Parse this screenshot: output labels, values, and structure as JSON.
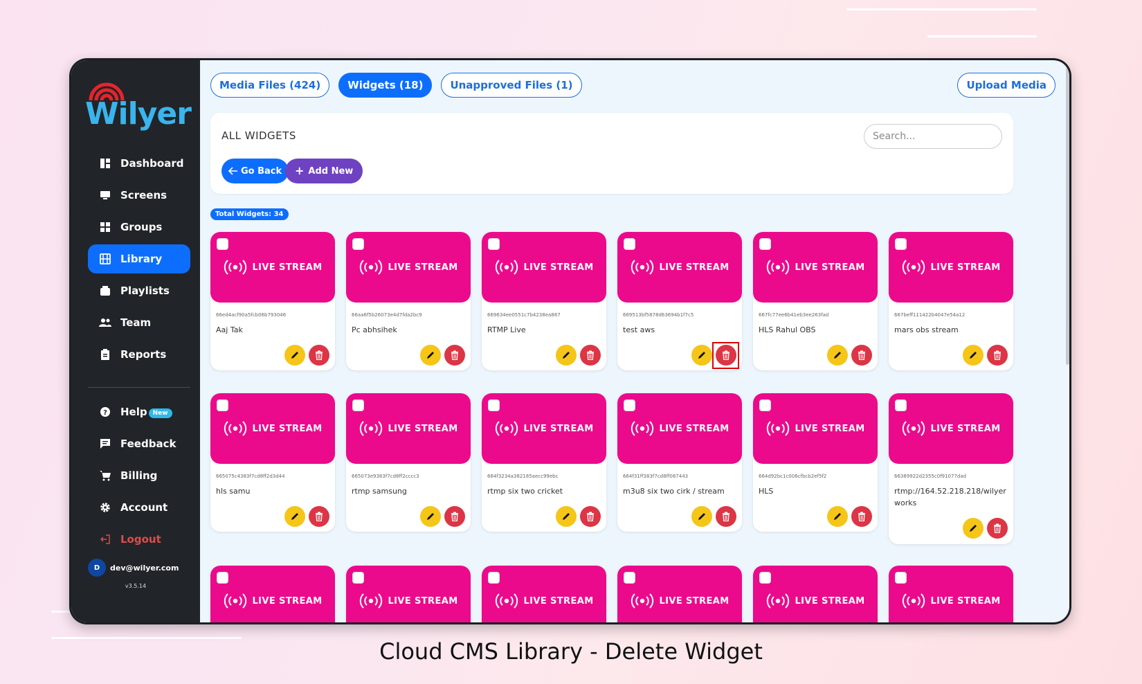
{
  "caption": "Cloud CMS Library - Delete Widget",
  "colors": {
    "primary": "#0d6efd",
    "widget_pink": "#ec0a8c",
    "edit": "#f5c518",
    "delete": "#dc3545",
    "add_new": "#6f42c1"
  },
  "brand": {
    "name": "Wilyer"
  },
  "sidebar": {
    "items": [
      {
        "label": "Dashboard",
        "icon": "dashboard-icon"
      },
      {
        "label": "Screens",
        "icon": "monitor-icon"
      },
      {
        "label": "Groups",
        "icon": "grid-icon"
      },
      {
        "label": "Library",
        "icon": "film-icon",
        "active": true
      },
      {
        "label": "Playlists",
        "icon": "playlist-icon"
      },
      {
        "label": "Team",
        "icon": "team-icon"
      },
      {
        "label": "Reports",
        "icon": "clipboard-icon"
      }
    ],
    "items2": [
      {
        "label": "Help",
        "icon": "help-icon",
        "badge": "New"
      },
      {
        "label": "Feedback",
        "icon": "feedback-icon"
      },
      {
        "label": "Billing",
        "icon": "cart-icon"
      },
      {
        "label": "Account",
        "icon": "gear-icon"
      },
      {
        "label": "Logout",
        "icon": "logout-icon"
      }
    ],
    "user": {
      "initial": "D",
      "email": "dev@wilyer.com"
    },
    "version": "v3.5.14"
  },
  "tabs": [
    {
      "label": "Media Files (424)"
    },
    {
      "label": "Widgets (18)",
      "active": true
    },
    {
      "label": "Unapproved Files (1)"
    }
  ],
  "upload_label": "Upload Media",
  "panel": {
    "title": "ALL WIDGETS",
    "search_placeholder": "Search...",
    "go_back": "Go Back",
    "add_new": "Add New"
  },
  "total_label": "Total Widgets: 34",
  "widget_label": "LIVE STREAM",
  "widgets": [
    {
      "id": "66ed4acf90a5fcb06b793046",
      "name": "Aaj Tak"
    },
    {
      "id": "66aa6f5b26073e4d7fda2bc9",
      "name": "Pc abhsihek"
    },
    {
      "id": "669634ee0551c7b4238ea887",
      "name": "RTMP Live"
    },
    {
      "id": "669513bf5878d63694b1f7c5",
      "name": "test aws",
      "highlight_delete": true
    },
    {
      "id": "667fc77ee6b41eb3ee263fad",
      "name": "HLS Rahul OBS"
    },
    {
      "id": "667beff111422b4047e54a12",
      "name": "mars obs stream"
    },
    {
      "id": "665075c4383f7cd8ff2d3d44",
      "name": "hls samu"
    },
    {
      "id": "665073e9383f7cd8ff2cccc3",
      "name": "rtmp samsung"
    },
    {
      "id": "664f3234a382185aecc99ebc",
      "name": "rtmp six two cricket"
    },
    {
      "id": "664f31ff383f7cd8ff087443",
      "name": "m3u8 six two cirk / stream"
    },
    {
      "id": "664d92bc1c006cfbcb2ef5f2",
      "name": "HLS"
    },
    {
      "id": "66389922d2355c0f91077dad",
      "name": "rtmp://164.52.218.218/wilyer works"
    },
    {
      "id": "",
      "name": ""
    },
    {
      "id": "",
      "name": ""
    },
    {
      "id": "",
      "name": ""
    },
    {
      "id": "",
      "name": ""
    },
    {
      "id": "",
      "name": ""
    },
    {
      "id": "",
      "name": ""
    }
  ]
}
